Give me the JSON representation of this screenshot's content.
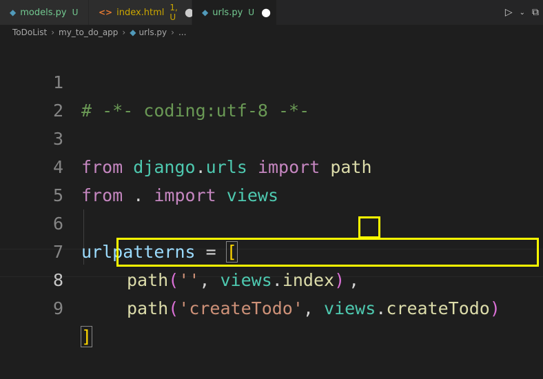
{
  "tabs": [
    {
      "icon": "python-file-icon",
      "glyph": "◆",
      "name": "models.py",
      "status": "U"
    },
    {
      "icon": "html-file-icon",
      "glyph": "<>",
      "name": "index.html",
      "status": "1, U",
      "dirty": "●"
    },
    {
      "icon": "python-file-icon",
      "glyph": "◆",
      "name": "urls.py",
      "status": "U",
      "dirty": "●"
    }
  ],
  "breadcrumb": [
    "ToDoList",
    "my_to_do_app",
    "urls.py",
    "..."
  ],
  "lines": [
    {
      "n": "1",
      "t1": "# -*- coding:utf-8 -*-"
    },
    {
      "n": "2"
    },
    {
      "n": "3",
      "t1": "from",
      "t2": " ",
      "t3": "django",
      "t4": ".",
      "t5": "urls",
      "t6": " ",
      "t7": "import",
      "t8": " ",
      "t9": "path"
    },
    {
      "n": "4",
      "t1": "from",
      "t2": " . ",
      "t3": "import",
      "t4": " ",
      "t5": "views"
    },
    {
      "n": "5"
    },
    {
      "n": "6",
      "t1": "urlpatterns",
      "t2": " = ",
      "t3": "["
    },
    {
      "n": "7",
      "t1": "path",
      "t2": "(",
      "t3": "''",
      "t4": ", ",
      "t5": "views",
      "t6": ".",
      "t7": "index",
      "t8": ")",
      "t9": ","
    },
    {
      "n": "8",
      "t1": "path",
      "t2": "(",
      "t3": "'createTodo'",
      "t4": ", ",
      "t5": "views",
      "t6": ".",
      "t7": "createTodo",
      "t8": ")"
    },
    {
      "n": "9",
      "t1": "]"
    }
  ],
  "colors": {
    "highlight_box": "#ffff00",
    "keyword": "#c586c0",
    "string": "#ce9178",
    "comment": "#6a9955"
  }
}
